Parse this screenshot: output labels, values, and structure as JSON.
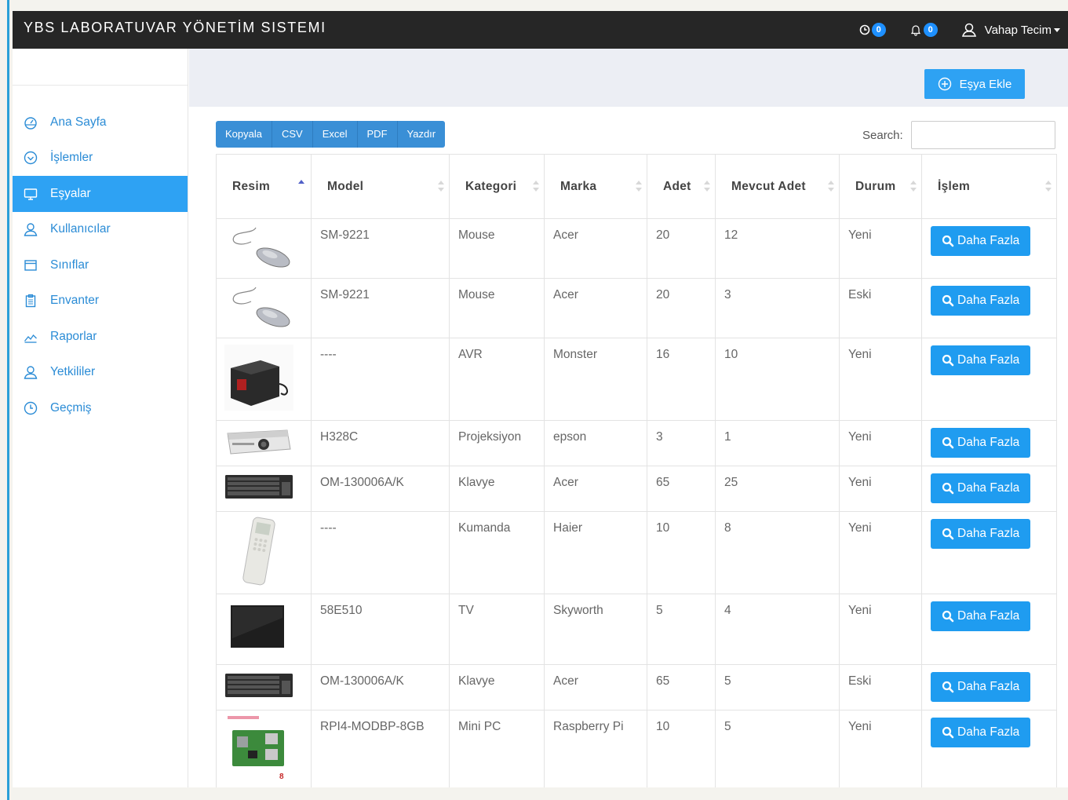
{
  "app": {
    "title": "YBS LABORATUVAR YÖNETİM SISTEMI"
  },
  "topbar": {
    "clock_count": "0",
    "bell_count": "0",
    "user_name": "Vahap Tecim"
  },
  "sidebar": {
    "items": [
      {
        "label": "Ana Sayfa",
        "icon": "dashboard-icon",
        "active": false
      },
      {
        "label": "İşlemler",
        "icon": "check-circle-icon",
        "active": false
      },
      {
        "label": "Eşyalar",
        "icon": "monitor-icon",
        "active": true
      },
      {
        "label": "Kullanıcılar",
        "icon": "user-icon",
        "active": false
      },
      {
        "label": "Sınıflar",
        "icon": "window-icon",
        "active": false
      },
      {
        "label": "Envanter",
        "icon": "clipboard-icon",
        "active": false
      },
      {
        "label": "Raporlar",
        "icon": "chart-icon",
        "active": false
      },
      {
        "label": "Yetkililer",
        "icon": "user-icon",
        "active": false
      },
      {
        "label": "Geçmiş",
        "icon": "clock-icon",
        "active": false
      }
    ]
  },
  "actions": {
    "add_label": "Eşya Ekle"
  },
  "toolbar": {
    "buttons": [
      "Kopyala",
      "CSV",
      "Excel",
      "PDF",
      "Yazdır"
    ]
  },
  "search": {
    "label": "Search:",
    "value": ""
  },
  "table": {
    "headers": [
      "Resim",
      "Model",
      "Kategori",
      "Marka",
      "Adet",
      "Mevcut Adet",
      "Durum",
      "İşlem"
    ],
    "action_label": "Daha Fazla",
    "rows": [
      {
        "image": "mouse",
        "model": "SM-9221",
        "kategori": "Mouse",
        "marka": "Acer",
        "adet": "20",
        "mevcut": "12",
        "durum": "Yeni"
      },
      {
        "image": "mouse",
        "model": "SM-9221",
        "kategori": "Mouse",
        "marka": "Acer",
        "adet": "20",
        "mevcut": "3",
        "durum": "Eski"
      },
      {
        "image": "avr",
        "model": "----",
        "kategori": "AVR",
        "marka": "Monster",
        "adet": "16",
        "mevcut": "10",
        "durum": "Yeni"
      },
      {
        "image": "projector",
        "model": "H328C",
        "kategori": "Projeksiyon",
        "marka": "epson",
        "adet": "3",
        "mevcut": "1",
        "durum": "Yeni"
      },
      {
        "image": "keyboard",
        "model": "OM-130006A/K",
        "kategori": "Klavye",
        "marka": "Acer",
        "adet": "65",
        "mevcut": "25",
        "durum": "Yeni"
      },
      {
        "image": "remote",
        "model": "----",
        "kategori": "Kumanda",
        "marka": "Haier",
        "adet": "10",
        "mevcut": "8",
        "durum": "Yeni"
      },
      {
        "image": "tv",
        "model": "58E510",
        "kategori": "TV",
        "marka": "Skyworth",
        "adet": "5",
        "mevcut": "4",
        "durum": "Yeni"
      },
      {
        "image": "keyboard",
        "model": "OM-130006A/K",
        "kategori": "Klavye",
        "marka": "Acer",
        "adet": "65",
        "mevcut": "5",
        "durum": "Eski"
      },
      {
        "image": "raspberry",
        "model": "RPI4-MODBP-8GB",
        "kategori": "Mini PC",
        "marka": "Raspberry Pi",
        "adet": "10",
        "mevcut": "5",
        "durum": "Yeni"
      }
    ]
  }
}
